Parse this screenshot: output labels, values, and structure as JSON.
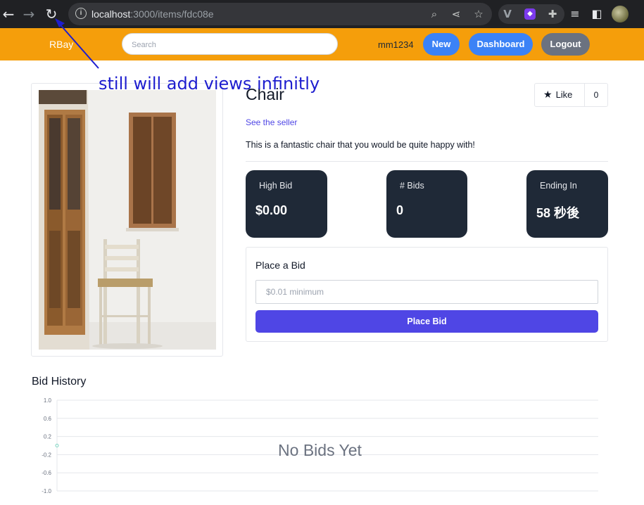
{
  "browser": {
    "url_host": "localhost",
    "url_path": ":3000/items/fdc08e",
    "icons": [
      "back-icon",
      "forward-icon",
      "reload-icon",
      "site-info-icon",
      "zoom-icon",
      "share-icon",
      "bookmark-star-icon",
      "extension-v-icon",
      "extension-purple-icon",
      "puzzle-icon",
      "media-queue-icon",
      "side-panel-icon",
      "profile-avatar"
    ]
  },
  "header": {
    "brand": "RBay",
    "search_placeholder": "Search",
    "username": "mm1234",
    "new_label": "New",
    "dashboard_label": "Dashboard",
    "logout_label": "Logout",
    "accent_color": "#f59e0b"
  },
  "item": {
    "title": "Chair",
    "like_label": "Like",
    "like_count": "0",
    "seller_link": "See the seller",
    "description": "This is a fantastic chair that you would be quite happy with!"
  },
  "stats": [
    {
      "label": "High Bid",
      "value": "$0.00"
    },
    {
      "label": "# Bids",
      "value": "0"
    },
    {
      "label": "Ending In",
      "value": "58 秒後"
    }
  ],
  "bid_form": {
    "heading": "Place a Bid",
    "placeholder": "$0.01 minimum",
    "button_label": "Place Bid",
    "button_color": "#4f46e5"
  },
  "history": {
    "title": "Bid History"
  },
  "chart_data": {
    "type": "line",
    "series": [
      {
        "values": [
          0
        ]
      }
    ],
    "y_ticks": [
      "1.0",
      "0.6",
      "0.2",
      "-0.2",
      "-0.6",
      "-1.0"
    ],
    "ylim": [
      -1.0,
      1.0
    ],
    "grid": true,
    "empty_message": "No Bids Yet"
  },
  "annotation": {
    "text": "still will add views infinitly",
    "color": "#1d1dcf"
  }
}
